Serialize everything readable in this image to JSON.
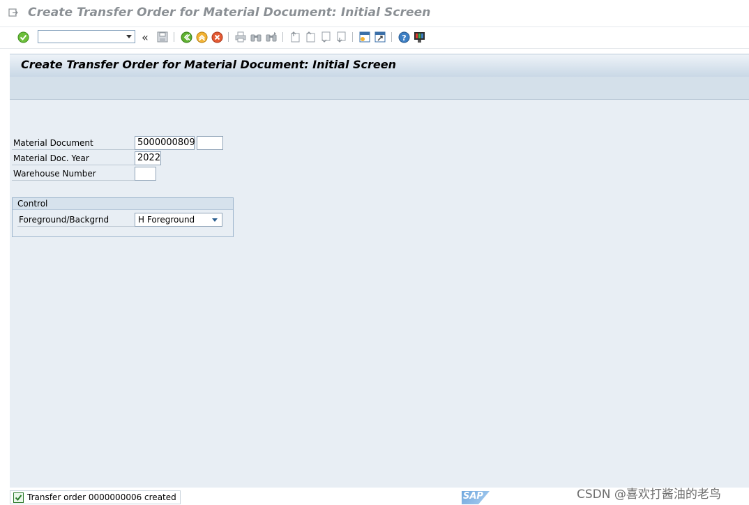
{
  "window": {
    "title": "Create Transfer Order for Material Document: Initial Screen"
  },
  "toolbar": {
    "command_value": "",
    "icons": [
      "enter-icon",
      "command-dropdown-icon",
      "collapse-icon",
      "save-icon",
      "back-icon",
      "exit-icon",
      "cancel-icon",
      "print-icon",
      "find-icon",
      "find-next-icon",
      "first-page-icon",
      "previous-page-icon",
      "next-page-icon",
      "last-page-icon",
      "create-session-icon",
      "shortcut-icon",
      "help-icon",
      "customize-layout-icon"
    ],
    "collapse_glyph": "«"
  },
  "screen": {
    "header": "Create Transfer Order for Material Document: Initial Screen"
  },
  "form": {
    "material_document_label": "Material Document",
    "material_document_value": "5000000809",
    "material_document_item_value": "",
    "material_doc_year_label": "Material Doc. Year",
    "material_doc_year_value": "2022",
    "warehouse_number_label": "Warehouse Number",
    "warehouse_number_value": ""
  },
  "control": {
    "group_title": "Control",
    "foreground_label": "Foreground/Backgrnd",
    "foreground_value": "H Foreground"
  },
  "status": {
    "message": "Transfer order 0000000006 created",
    "sap_logo": "SAP"
  },
  "watermark": "CSDN @喜欢打酱油的老鸟",
  "colors": {
    "work_area": "#e8eef4",
    "header_gradient_bottom": "#c9d8e6",
    "success_green": "#2b7a2b"
  }
}
